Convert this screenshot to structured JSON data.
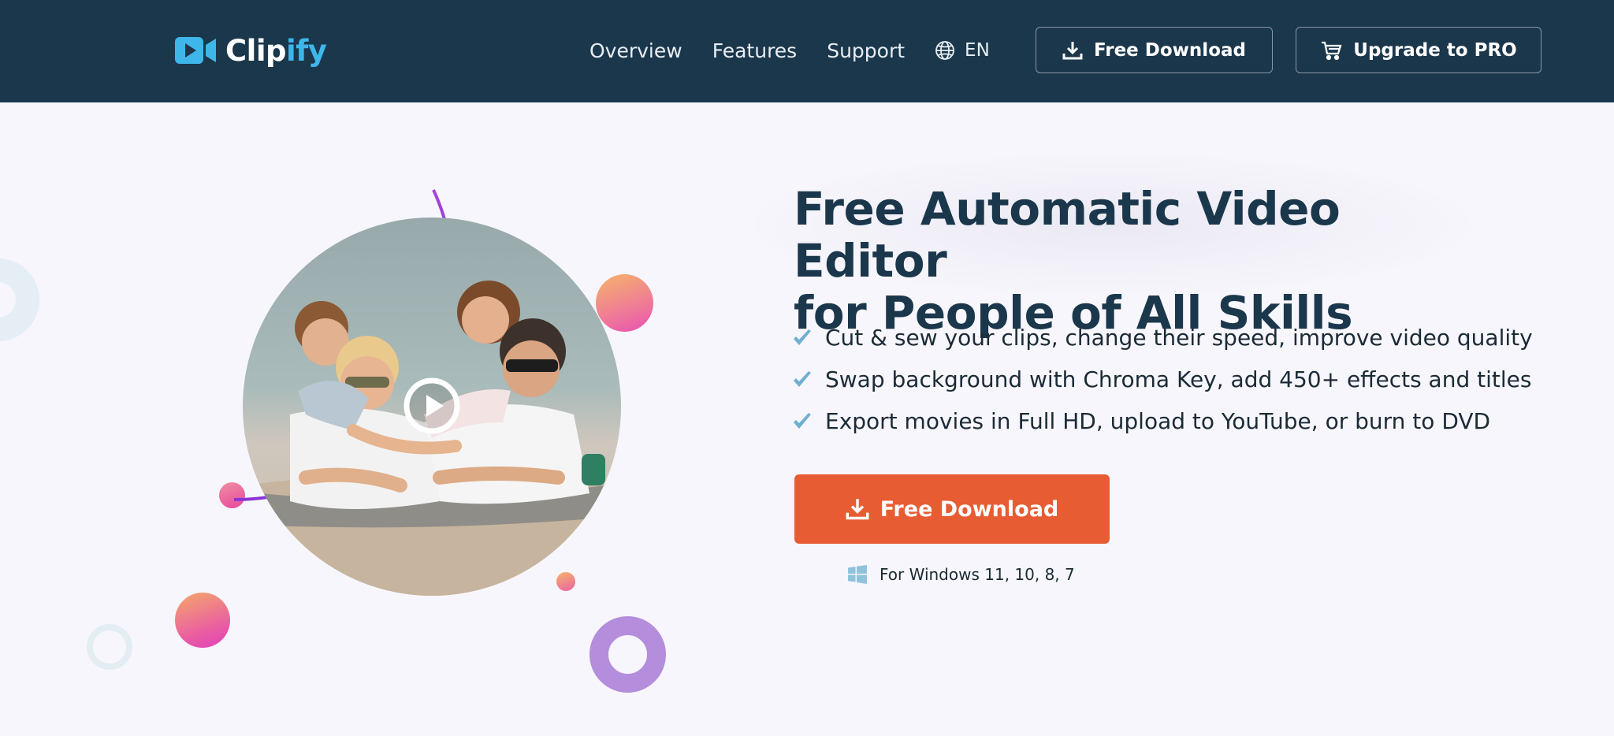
{
  "brand": {
    "name_part1": "Clip",
    "name_part2": "ify",
    "logo_icon": "video-camera-icon",
    "colors": {
      "header_bg": "#1b374c",
      "accent": "#3fb6ea",
      "cta": "#e85c33",
      "headline": "#1b374c"
    }
  },
  "nav": {
    "items": [
      {
        "label": "Overview"
      },
      {
        "label": "Features"
      },
      {
        "label": "Support"
      }
    ],
    "language": {
      "icon": "globe-icon",
      "label": "EN"
    }
  },
  "header_buttons": {
    "download": {
      "label": "Free Download",
      "icon": "download-icon"
    },
    "upgrade": {
      "label": "Upgrade to PRO",
      "icon": "cart-icon"
    }
  },
  "hero": {
    "headline_line1": "Free Automatic Video Editor",
    "headline_line2": "for People of All Skills",
    "features": [
      "Cut & sew your clips, change their speed, improve video quality",
      "Swap background with Chroma Key, add 450+ effects and titles",
      "Export movies in Full HD, upload to YouTube, or burn to DVD"
    ],
    "feature_icon": "checkmark-icon",
    "cta": {
      "label": "Free Download",
      "icon": "download-icon"
    },
    "os_note": {
      "icon": "windows-icon",
      "label": "For Windows 11, 10, 8, 7"
    }
  },
  "video": {
    "thumbnail": "family-on-beach-photo",
    "play_icon": "play-icon"
  }
}
